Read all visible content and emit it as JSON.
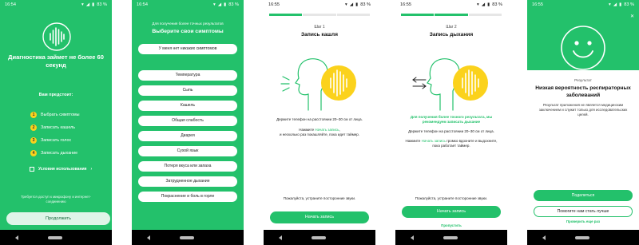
{
  "colors": {
    "accent_green": "#23c16b",
    "yellow": "#fbd21c"
  },
  "status": {
    "time_1": "16:54",
    "time_2": "16:54",
    "time_3": "16:55",
    "time_4": "16:55",
    "time_5": "16:55",
    "battery": "83 %"
  },
  "intro": {
    "title": "Диагностика займет не более 60 секунд",
    "subtitle": "Вам предстоит:",
    "steps": [
      {
        "num": "1",
        "label": "Выбрать симптомы"
      },
      {
        "num": "2",
        "label": "Записать кашель"
      },
      {
        "num": "3",
        "label": "Записать голос"
      },
      {
        "num": "4",
        "label": "Записать дыхание"
      }
    ],
    "terms": "Условия использования",
    "note": "Требуется доступ к микрофону и интернет-соединению",
    "continue_button": "Продолжить"
  },
  "symptoms": {
    "hint": "Для получения более точных результатов",
    "title": "Выберите свои симптомы",
    "options": [
      "У меня нет никаких симптомов",
      "Температура",
      "Сыпь",
      "Кашель",
      "Общая слабость",
      "Диарея",
      "Сухой язык",
      "Потеря вкуса или запаха",
      "Затрудненное дыхание",
      "Покраснение и боль в горле"
    ]
  },
  "cough": {
    "step": "Шаг 1",
    "title": "Запись кашля",
    "hold": "Держите телефон на расстоянии 20–30 см от лица.",
    "press_prefix": "Нажмите ",
    "press_link": "Начать запись",
    "press_suffix": ",",
    "press_rest": "и несколько раз покашляйте, пока идет таймер.",
    "silence": "Пожалуйста, устраните посторонние звуки.",
    "start_button": "Начать запись"
  },
  "breath": {
    "step": "Шаг 2",
    "title": "Запись дыхания",
    "advice": "Для получения более точного результата, мы рекомендуем записать дыхание",
    "hold": "Держите телефон на расстоянии 20–30 см от лица.",
    "press_prefix": "Нажмите ",
    "press_link": "Начать запись",
    "press_rest": " громко вдохните и выдохните, пока работает таймер.",
    "silence": "Пожалуйста, устраните посторонние звуки.",
    "start_button": "Начать запись",
    "skip": "Пропустить"
  },
  "result": {
    "label": "Результат",
    "title": "Низкая вероятность респираторных заболеваний",
    "desc": "Результат приложения не является медицинским заключением и служит только для исследовательских целей.",
    "share_button": "Поделиться",
    "help_button": "Помогите нам стать лучше",
    "recheck": "Проверить еще раз"
  }
}
